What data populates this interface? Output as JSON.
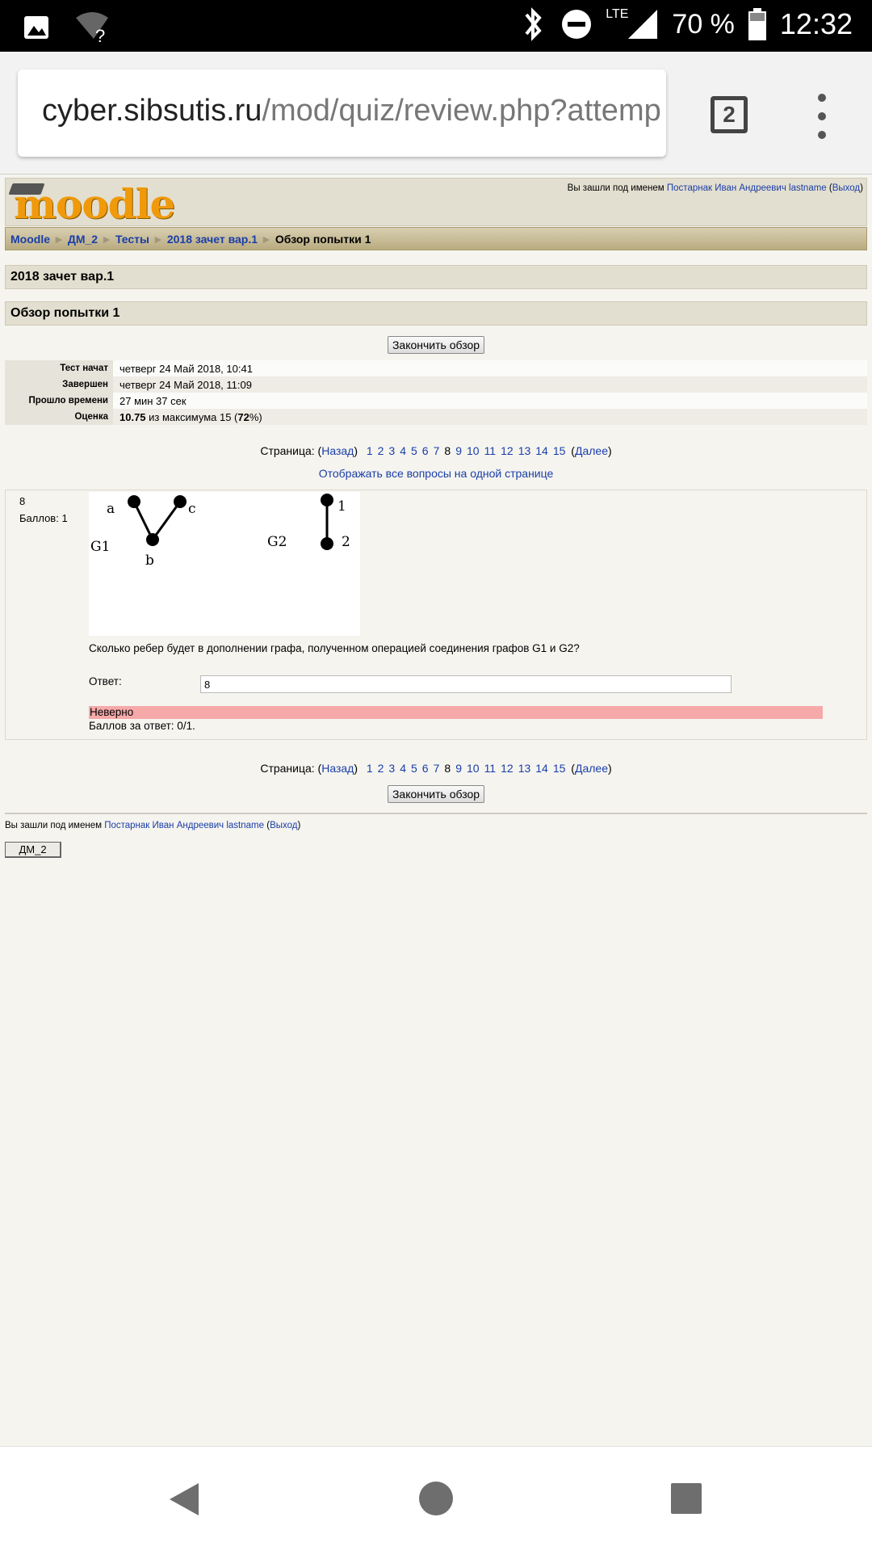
{
  "status_bar": {
    "network": "LTE",
    "battery": "70 %",
    "time": "12:32"
  },
  "browser": {
    "url_host": "cyber.sibsutis.ru",
    "url_path": "/mod/quiz/review.php?attemp",
    "tab_count": "2"
  },
  "header": {
    "logo_text": "moodle",
    "login_prefix": "Вы зашли под именем ",
    "user_name": "Постарнак Иван Андреевич lastname",
    "logout_label": "Выход"
  },
  "breadcrumb": [
    "Moodle",
    "ДМ_2",
    "Тесты",
    "2018 зачет вар.1",
    "Обзор попытки 1"
  ],
  "quiz_title": "2018 зачет вар.1",
  "review_title": "Обзор попытки 1",
  "finish_review_label": "Закончить обзор",
  "summary": [
    {
      "label": "Тест начат",
      "value": "четверг 24 Май 2018, 10:41"
    },
    {
      "label": "Завершен",
      "value": "четверг 24 Май 2018, 11:09"
    },
    {
      "label": "Прошло времени",
      "value": "27 мин 37 сек"
    }
  ],
  "grade": {
    "label": "Оценка",
    "score": "10.75",
    "middle": " из максимума 15 (",
    "percent": "72",
    "suffix": "%)"
  },
  "pager": {
    "prefix": "Страница: (",
    "prev": "Назад",
    "close": ")",
    "pages": [
      "1",
      "2",
      "3",
      "4",
      "5",
      "6",
      "7",
      "8",
      "9",
      "10",
      "11",
      "12",
      "13",
      "14",
      "15"
    ],
    "current": "8",
    "next": "Далее",
    "show_all": "Отображать все вопросы на одной странице"
  },
  "question": {
    "number": "8",
    "marks": "Баллов: 1",
    "graph_labels": {
      "a": "a",
      "b": "b",
      "c": "c",
      "g1": "G1",
      "g2": "G2",
      "n1": "1",
      "n2": "2"
    },
    "text": "Сколько ребер будет в дополнении графа, полученном операцией соединения графов G1 и G2?",
    "answer_label": "Ответ:",
    "answer_value": "8",
    "result": "Неверно",
    "score_text": "Баллов за ответ: 0/1."
  },
  "footer": {
    "course_button": "ДМ_2"
  },
  "colors": {
    "incorrect_bg": "#f5a9a9",
    "link": "#1a3ea8",
    "header_bg": "#e3dfd0"
  }
}
